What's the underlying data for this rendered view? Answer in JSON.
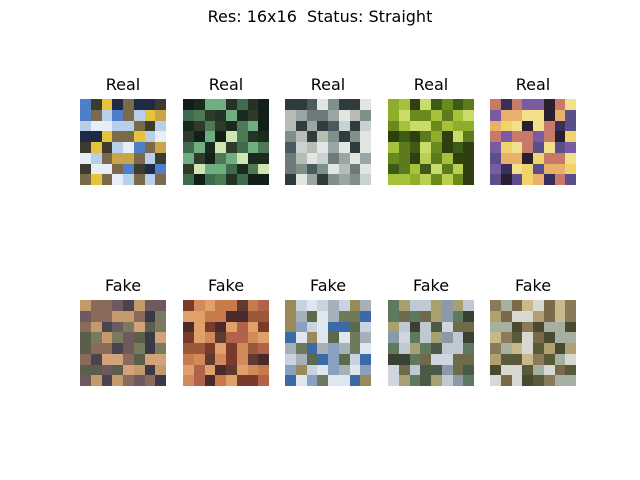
{
  "figure": {
    "suptitle": "Res: 16x16  Status: Straight"
  },
  "rows": [
    {
      "label": "Real",
      "panels": [
        {
          "title": "Real",
          "palette": [
            "#4f7fc8",
            "#b7cfe8",
            "#e8eef7",
            "#7a6a4a",
            "#c9a54a",
            "#3b3b2f",
            "#1f2a44",
            "#e5c33a"
          ]
        },
        {
          "title": "Real",
          "palette": [
            "#2f3a2a",
            "#1a2a1e",
            "#3f6b4e",
            "#6fae7e",
            "#cfe6b2",
            "#243326",
            "#4d7a55",
            "#13201a"
          ]
        },
        {
          "title": "Real",
          "palette": [
            "#4a5a5e",
            "#c8d2d2",
            "#9aa6a6",
            "#6e7a7a",
            "#e1e6e3",
            "#2f3b3d",
            "#b7bdb5",
            "#7f8f8a"
          ]
        },
        {
          "title": "Real",
          "palette": [
            "#6b8a1e",
            "#a6c23a",
            "#3f5a16",
            "#c9dc6a",
            "#8fae2c",
            "#2f3f12",
            "#b8cf52",
            "#5d7a1e"
          ]
        },
        {
          "title": "Real",
          "palette": [
            "#5b4f8a",
            "#e8b06a",
            "#f0d36a",
            "#c77a6a",
            "#7a5aa0",
            "#3a2f5a",
            "#f2e08a",
            "#2a1f2f"
          ]
        }
      ]
    },
    {
      "label": "Fake",
      "panels": [
        {
          "title": "Fake",
          "palette": [
            "#4a4350",
            "#8a6a5a",
            "#c59a6a",
            "#5a5e4a",
            "#3a3a46",
            "#d2a27a",
            "#6e5a5e",
            "#7a7a5e"
          ]
        },
        {
          "title": "Fake",
          "palette": [
            "#7a3a2a",
            "#c77a4a",
            "#e0a06a",
            "#4a2a2a",
            "#9a5a3a",
            "#d28a5a",
            "#5e3a30",
            "#b0624a"
          ]
        },
        {
          "title": "Fake",
          "palette": [
            "#8aa0c0",
            "#c8d2e0",
            "#6e7a5a",
            "#a6b0b8",
            "#5a6a4a",
            "#e0e6ee",
            "#3a6aa8",
            "#9a8a5a"
          ]
        },
        {
          "title": "Fake",
          "palette": [
            "#4a5a46",
            "#8a9aa8",
            "#c0c8d2",
            "#6e6a4a",
            "#3a4032",
            "#a8a070",
            "#5e7a5e",
            "#d0d6e0"
          ]
        },
        {
          "title": "Fake",
          "palette": [
            "#7a6a4a",
            "#a6b0a0",
            "#c8b88a",
            "#5a5a3a",
            "#d8d8d2",
            "#8a7a5a",
            "#4a4a32",
            "#b0a070"
          ]
        }
      ]
    }
  ]
}
